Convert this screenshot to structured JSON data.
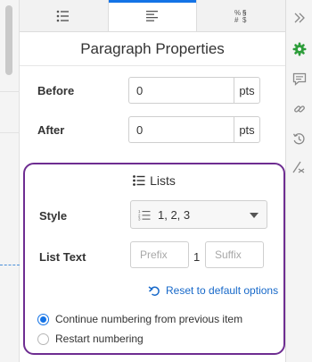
{
  "tabs": [
    {
      "name": "list-format-icon",
      "active": false
    },
    {
      "name": "paragraph-align-icon",
      "active": true
    },
    {
      "name": "special-characters-icon",
      "label": "%§\n#$",
      "active": false
    }
  ],
  "panel": {
    "title": "Paragraph Properties",
    "before": {
      "label": "Before",
      "value": "0",
      "unit": "pts"
    },
    "after": {
      "label": "After",
      "value": "0",
      "unit": "pts"
    }
  },
  "lists": {
    "heading": "Lists",
    "style_label": "Style",
    "style_value": "1, 2, 3",
    "list_text_label": "List Text",
    "prefix_placeholder": "Prefix",
    "suffix_placeholder": "Suffix",
    "list_number": "1",
    "reset_label": "Reset to default options",
    "options": [
      {
        "label": "Continue numbering from previous item",
        "checked": true
      },
      {
        "label": "Restart numbering",
        "checked": false
      }
    ]
  },
  "rail": {
    "icons": [
      "double-chevron-right-icon",
      "gear-icon",
      "comment-icon",
      "link-icon",
      "history-icon",
      "clear-format-icon"
    ],
    "colors": {
      "gear": "#2d9d3a",
      "icon": "#8a8a8a"
    }
  },
  "colors": {
    "accent": "#1473e6",
    "highlight_border": "#6e2d91",
    "link": "#1668c9"
  }
}
